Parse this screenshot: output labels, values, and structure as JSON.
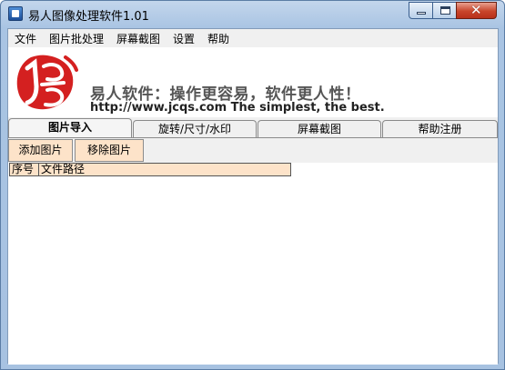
{
  "window": {
    "title": "易人图像处理软件1.01",
    "controls": {
      "minimize_icon": "minimize-icon",
      "maximize_icon": "maximize-icon",
      "close_icon": "close-icon",
      "close_glyph": "✕"
    }
  },
  "menu": {
    "items": [
      {
        "label": "文件"
      },
      {
        "label": "图片批处理"
      },
      {
        "label": "屏幕截图"
      },
      {
        "label": "设置"
      },
      {
        "label": "帮助"
      }
    ]
  },
  "banner": {
    "slogan": "易人软件：操作更容易，软件更人性！",
    "site": "http://www.jcqs.com  The simplest, the best.",
    "logo_color": "#d42020"
  },
  "tabs": [
    {
      "label": "图片导入",
      "active": true
    },
    {
      "label": "旋转/尺寸/水印",
      "active": false
    },
    {
      "label": "屏幕截图",
      "active": false
    },
    {
      "label": "帮助注册",
      "active": false
    }
  ],
  "toolbar": {
    "add_label": "添加图片",
    "remove_label": "移除图片"
  },
  "file_list": {
    "columns": [
      {
        "label": "序号"
      },
      {
        "label": "文件路径"
      }
    ],
    "rows": []
  },
  "colors": {
    "button_bg": "#fde3c9",
    "chrome": "#a9c4e3",
    "close_red": "#c8452a"
  }
}
